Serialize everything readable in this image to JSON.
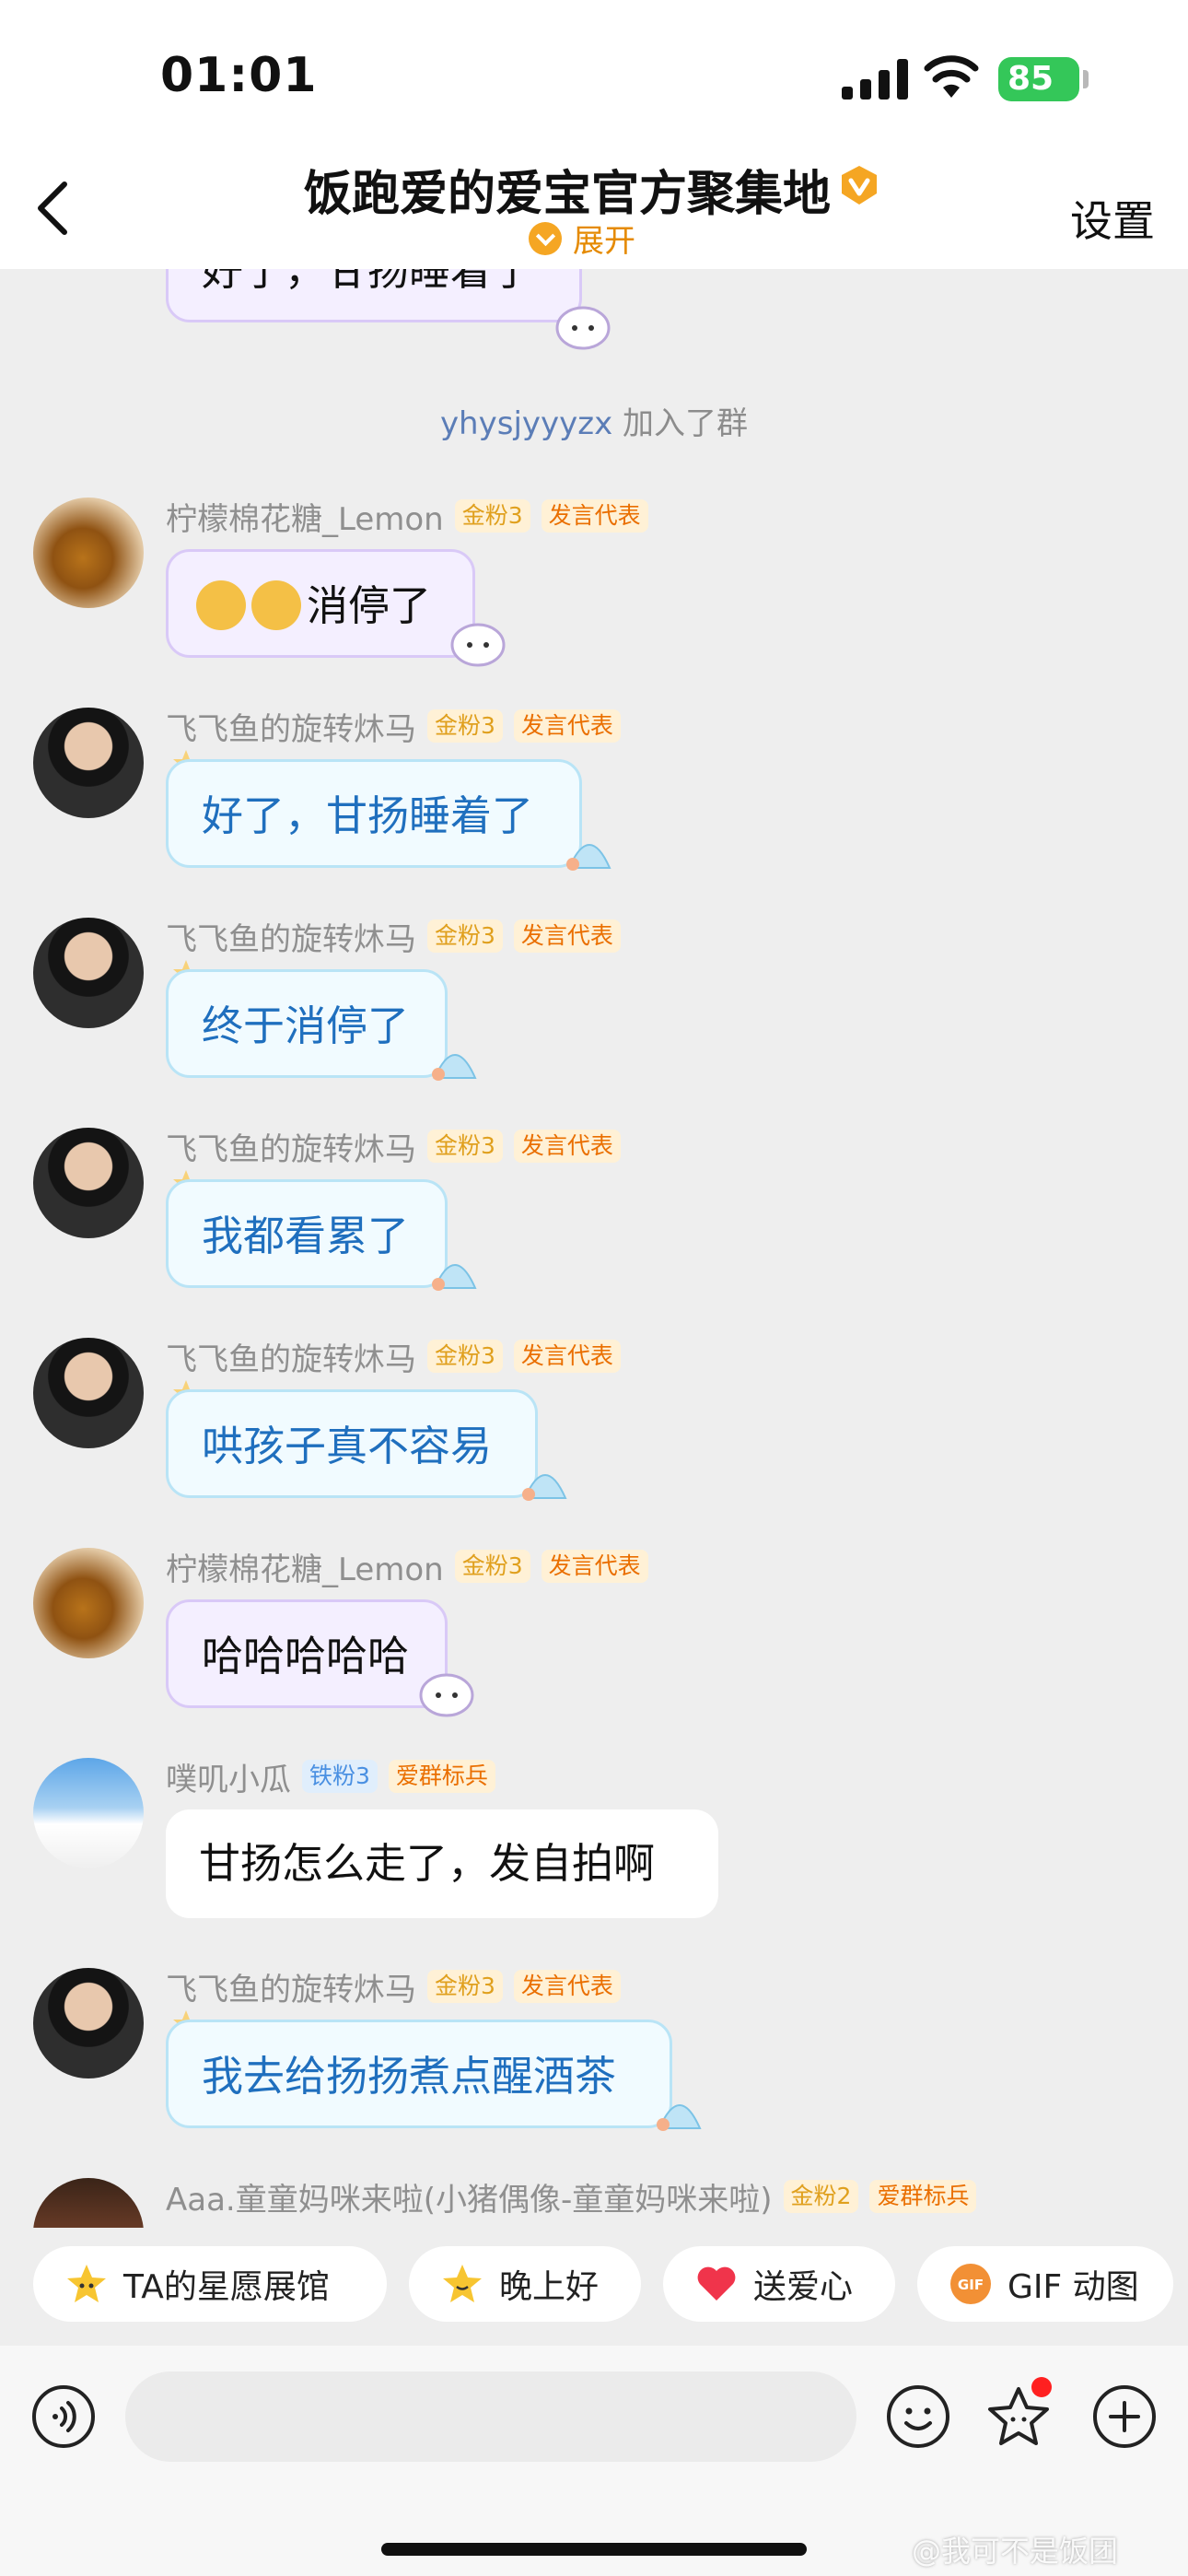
{
  "status_bar": {
    "time": "01:01",
    "battery": "85"
  },
  "header": {
    "title": "饭跑爱的爱宝官方聚集地",
    "expand_label": "展开",
    "settings_label": "设置"
  },
  "messages": [
    {
      "type": "partial",
      "text": "好了，甘扬睡着了"
    },
    {
      "type": "system",
      "user": "yhysjyyyzx",
      "action": "加入了群"
    },
    {
      "nickname": "柠檬棉花糖_Lemon",
      "level_badge": "金粉3",
      "role_badge": "发言代表",
      "text": "消停了"
    },
    {
      "nickname": "飞飞鱼的旋转炑马",
      "level_badge": "金粉3",
      "role_badge": "发言代表",
      "text": "好了，甘扬睡着了"
    },
    {
      "nickname": "飞飞鱼的旋转炑马",
      "level_badge": "金粉3",
      "role_badge": "发言代表",
      "text": "终于消停了"
    },
    {
      "nickname": "飞飞鱼的旋转炑马",
      "level_badge": "金粉3",
      "role_badge": "发言代表",
      "text": "我都看累了"
    },
    {
      "nickname": "飞飞鱼的旋转炑马",
      "level_badge": "金粉3",
      "role_badge": "发言代表",
      "text": "哄孩子真不容易"
    },
    {
      "nickname": "柠檬棉花糖_Lemon",
      "level_badge": "金粉3",
      "role_badge": "发言代表",
      "text": "哈哈哈哈哈"
    },
    {
      "nickname": "噗叽小瓜",
      "level_badge": "铁粉3",
      "role_badge": "爱群标兵",
      "text": "甘扬怎么走了，发自拍啊"
    },
    {
      "nickname": "飞飞鱼的旋转炑马",
      "level_badge": "金粉3",
      "role_badge": "发言代表",
      "text": "我去给扬扬煮点醒酒茶"
    },
    {
      "nickname": "Aaa.童童妈咪来啦(小猪偶像-童童妈咪来啦)",
      "level_badge": "金粉2",
      "role_badge": "爱群标兵"
    }
  ],
  "quick_replies": [
    {
      "label": "TA的星愿展馆",
      "icon": "star-face-icon"
    },
    {
      "label": "晚上好",
      "icon": "sparkle-face-icon"
    },
    {
      "label": "送爱心",
      "icon": "heart-icon"
    },
    {
      "label": "GIF 动图",
      "icon": "gif-icon"
    }
  ],
  "input": {
    "placeholder": ""
  },
  "watermark": "@我可不是饭团",
  "colors": {
    "accent_orange": "#f5a623",
    "blue_text": "#1f6fbe",
    "bubble_purple": "#f4efff",
    "bubble_blue": "#f1fbff"
  }
}
